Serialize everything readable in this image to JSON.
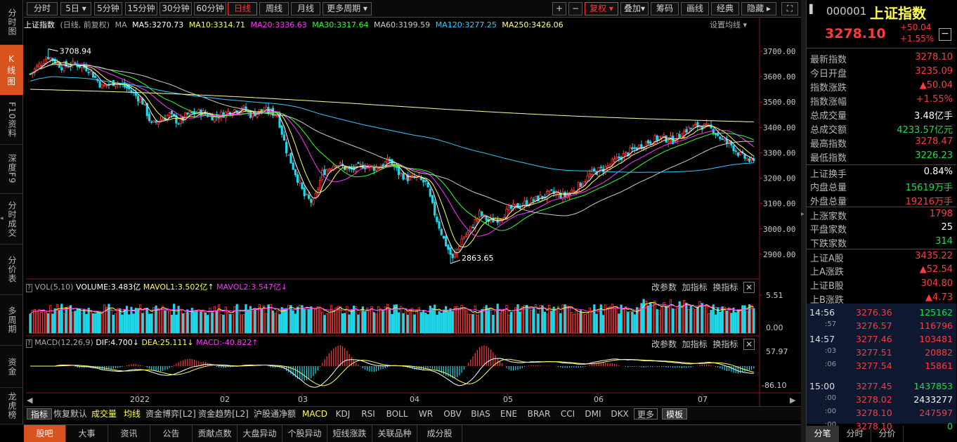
{
  "leftnav": [
    {
      "label": "分时图"
    },
    {
      "label": "K线图"
    },
    {
      "label": "F10资料"
    },
    {
      "label": "深度F9"
    },
    {
      "label": "分时成交"
    },
    {
      "label": "分价表"
    },
    {
      "label": "多周期"
    },
    {
      "label": "资金"
    },
    {
      "label": "龙虎榜"
    }
  ],
  "periods": [
    "分时",
    "5日",
    "5分钟",
    "15分钟",
    "30分钟",
    "60分钟",
    "日线",
    "周线",
    "月线",
    "更多周期"
  ],
  "active_period": "日线",
  "toolbar_right": [
    "+",
    "−",
    "复权",
    "叠加",
    "筹码",
    "画线",
    "经典",
    "隐藏"
  ],
  "info": {
    "name": "上证指数",
    "mode": "(日线, 前复权)",
    "ma_label": "MA",
    "ma5": "MA5:3270.73",
    "ma10": "MA10:3314.71",
    "ma20": "MA20:3336.63",
    "ma30": "MA30:3317.64",
    "ma60": "MA60:3199.59",
    "ma120": "MA120:3277.25",
    "ma250": "MA250:3426.06",
    "settings": "设置均线"
  },
  "vol": {
    "label": "VOL(5,10)",
    "volume": "VOLUME:3.483亿",
    "mavol1": "MAVOL1:3.502亿",
    "mavol2": "MAVOL2:3.547亿",
    "actions": [
      "改参数",
      "加指标",
      "换指标"
    ],
    "axis": [
      "5.51",
      "0.00"
    ]
  },
  "macd": {
    "label": "MACD(12,26,9)",
    "dif": "DIF:4.700",
    "dea": "DEA:25.111",
    "macd": "MACD:-40.822",
    "actions": [
      "改参数",
      "加指标",
      "换指标"
    ],
    "axis": [
      "57.97",
      "-86.10"
    ]
  },
  "price_axis": [
    "3700.00",
    "3600.00",
    "3500.00",
    "3400.00",
    "3300.00",
    "3200.00",
    "3100.00",
    "3000.00",
    "2900.00"
  ],
  "annotations": {
    "high": "3708.94",
    "low": "2863.65"
  },
  "x_labels": [
    "2022",
    "02",
    "03",
    "04",
    "05",
    "06",
    "07"
  ],
  "indicator_bar": [
    "指标",
    "恢复默认",
    "成交量",
    "均线",
    "资金博弈[L2]",
    "资金趋势[L2]",
    "沪股通净额",
    "MACD",
    "KDJ",
    "RSI",
    "BOLL",
    "WR",
    "OBV",
    "BIAS",
    "ENE",
    "BRAR",
    "CCI",
    "DMI",
    "DKX",
    "更多",
    "模板"
  ],
  "bottom_tabs": [
    "股吧",
    "大事",
    "资讯",
    "公告",
    "贡献点数",
    "大盘异动",
    "个股异动",
    "短线涨跌",
    "关联品种",
    "成分股"
  ],
  "quote": {
    "code": "000001",
    "name": "上证指数",
    "price": "3278.10",
    "change": "+50.04",
    "pct": "+1.55%"
  },
  "stats": [
    {
      "k": "最新指数",
      "v": "3278.10",
      "c": "red"
    },
    {
      "k": "今日开盘",
      "v": "3235.09",
      "c": "red"
    },
    {
      "k": "指数涨跌",
      "v": "▲50.04",
      "c": "red"
    },
    {
      "k": "指数涨幅",
      "v": "+1.55%",
      "c": "red"
    },
    {
      "k": "总成交量",
      "v": "3.48亿手",
      "c": "white"
    },
    {
      "k": "总成交额",
      "v": "4233.57亿元",
      "c": "green"
    },
    {
      "k": "最高指数",
      "v": "3278.47",
      "c": "red"
    },
    {
      "k": "最低指数",
      "v": "3226.23",
      "c": "green"
    },
    {
      "k": "上证换手",
      "v": "0.84%",
      "c": "white"
    },
    {
      "k": "内盘总量",
      "v": "15619万手",
      "c": "green"
    },
    {
      "k": "外盘总量",
      "v": "19216万手",
      "c": "red"
    },
    {
      "k": "上涨家数",
      "v": "1798",
      "c": "red"
    },
    {
      "k": "平盘家数",
      "v": "25",
      "c": "white"
    },
    {
      "k": "下跌家数",
      "v": "314",
      "c": "green"
    },
    {
      "k": "上证A股",
      "v": "3435.22",
      "c": "red"
    },
    {
      "k": "上A涨跌",
      "v": "▲52.54",
      "c": "red"
    },
    {
      "k": "上证B股",
      "v": "304.80",
      "c": "red"
    },
    {
      "k": "上B涨跌",
      "v": "▲4.73",
      "c": "red"
    }
  ],
  "ticks": [
    {
      "t": "14:56",
      "p": "3276.36",
      "v": "125162",
      "vc": "green"
    },
    {
      "t": ":57",
      "p": "3276.57",
      "v": "116796",
      "vc": "red"
    },
    {
      "t": "14:57",
      "p": "3277.46",
      "v": "103481",
      "vc": "red"
    },
    {
      "t": ":03",
      "p": "3277.51",
      "v": "20882",
      "vc": "red"
    },
    {
      "t": ":06",
      "p": "3277.54",
      "v": "15861",
      "vc": "red"
    },
    {
      "t": "15:00",
      "p": "3277.45",
      "v": "1437853",
      "vc": "green"
    },
    {
      "t": ":00",
      "p": "3278.02",
      "v": "2433277",
      "vc": "white"
    },
    {
      "t": ":00",
      "p": "3278.10",
      "v": "247597",
      "vc": "red"
    },
    {
      "t": ":00",
      "p": "3278.10",
      "v": "0",
      "vc": "green"
    }
  ],
  "right_tabs": [
    "分笔",
    "分时",
    "分价"
  ],
  "colors": {
    "up": "#ff3b3b",
    "down": "#1fd7e8",
    "accent": "#d8531d",
    "ma5": "#ffffff",
    "ma10": "#ffff4d",
    "ma20": "#ff33ff",
    "ma30": "#33ff33",
    "ma60": "#cccccc",
    "ma120": "#33ccff",
    "ma250": "#ffff99"
  }
}
